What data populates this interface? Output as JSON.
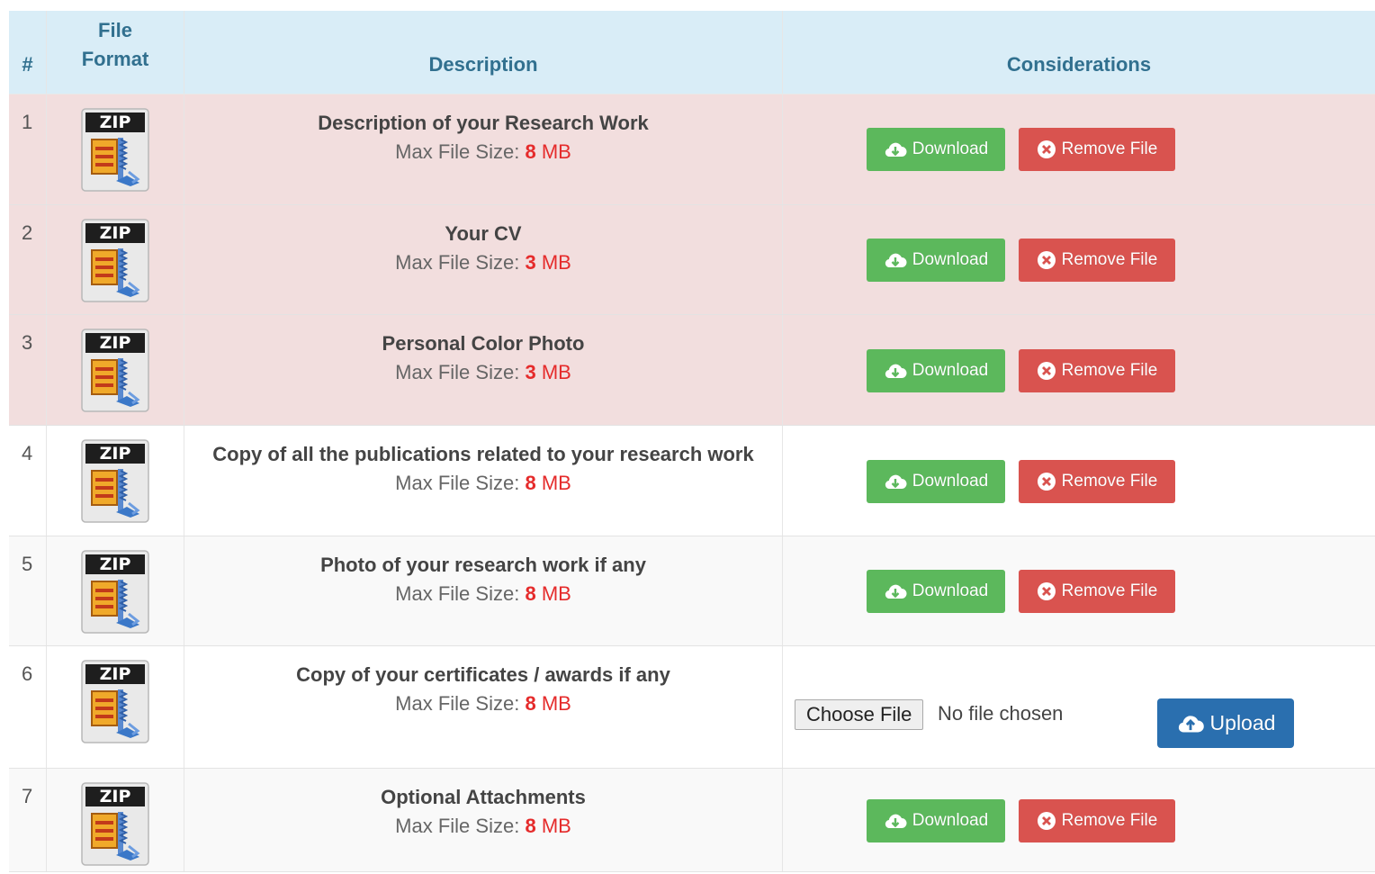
{
  "header": {
    "num": "#",
    "format": "File\nFormat",
    "format_line1": "File",
    "format_line2": "Format",
    "description": "Description",
    "considerations": "Considerations"
  },
  "labels": {
    "max_size": "Max File Size: ",
    "unit": "MB",
    "download": "Download",
    "remove": "Remove File",
    "choose": "Choose File",
    "no_file": "No file chosen",
    "upload": "Upload",
    "zip": "ZIP"
  },
  "rows": [
    {
      "num": "1",
      "title": "Description of your Research Work",
      "size": "8",
      "status": "uploaded"
    },
    {
      "num": "2",
      "title": "Your CV",
      "size": "3",
      "status": "uploaded"
    },
    {
      "num": "3",
      "title": "Personal Color Photo",
      "size": "3",
      "status": "uploaded"
    },
    {
      "num": "4",
      "title": "Copy of all the publications related to your research work",
      "size": "8",
      "status": "uploaded"
    },
    {
      "num": "5",
      "title": "Photo of your research work if any",
      "size": "8",
      "status": "uploaded"
    },
    {
      "num": "6",
      "title": "Copy of your certificates / awards if any",
      "size": "8",
      "status": "empty"
    },
    {
      "num": "7",
      "title": "Optional Attachments",
      "size": "8",
      "status": "uploaded"
    }
  ],
  "colors": {
    "header_bg": "#d9edf7",
    "header_text": "#31708f",
    "danger_row": "#f2dede",
    "download": "#5cb85c",
    "remove": "#d9534f",
    "upload": "#2a6faf",
    "size_value": "#e52b2b"
  },
  "icons": {
    "file_format": "zip-file-icon",
    "download": "cloud-download-icon",
    "remove": "circle-x-icon",
    "upload": "cloud-upload-icon"
  }
}
